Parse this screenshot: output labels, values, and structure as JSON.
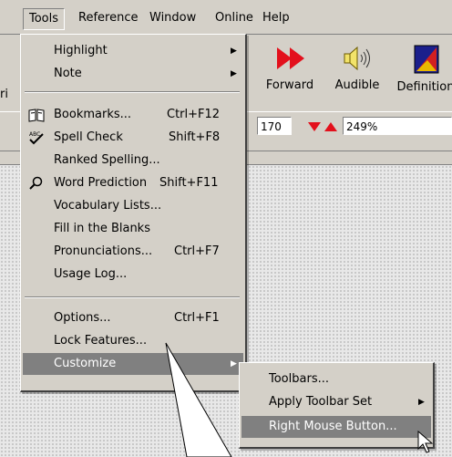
{
  "menubar": {
    "items": [
      "Tools",
      "Reference",
      "Window",
      "Online",
      "Help"
    ]
  },
  "toolbar": {
    "buttons": [
      {
        "label": "ri",
        "icon": "partial-button-icon"
      },
      {
        "label": "Forward",
        "icon": "forward-arrows-icon"
      },
      {
        "label": "Audible",
        "icon": "speaker-icon"
      },
      {
        "label": "Definition",
        "icon": "dictionary-book-icon"
      }
    ],
    "field1": "170",
    "zoom": "249%"
  },
  "tools_menu": {
    "items": [
      {
        "label": "Highlight",
        "shortcut": "",
        "submenu": true
      },
      {
        "label": "Note",
        "shortcut": "",
        "submenu": true
      },
      {
        "label": "Bookmarks...",
        "shortcut": "Ctrl+F12",
        "icon": "bookmarks-book-icon"
      },
      {
        "label": "Spell Check",
        "shortcut": "Shift+F8",
        "icon": "spellcheck-icon"
      },
      {
        "label": "Ranked Spelling...",
        "shortcut": ""
      },
      {
        "label": "Word Prediction",
        "shortcut": "Shift+F11",
        "icon": "magnifier-icon"
      },
      {
        "label": "Vocabulary Lists...",
        "shortcut": ""
      },
      {
        "label": "Fill in the Blanks",
        "shortcut": ""
      },
      {
        "label": "Pronunciations...",
        "shortcut": "Ctrl+F7"
      },
      {
        "label": "Usage Log...",
        "shortcut": ""
      },
      {
        "label": "Options...",
        "shortcut": "Ctrl+F1"
      },
      {
        "label": "Lock Features...",
        "shortcut": ""
      },
      {
        "label": "Customize",
        "shortcut": "",
        "submenu": true,
        "highlighted": true
      }
    ]
  },
  "customize_menu": {
    "items": [
      {
        "label": "Toolbars...",
        "submenu": false
      },
      {
        "label": "Apply Toolbar Set",
        "submenu": true
      },
      {
        "label": "Right Mouse Button...",
        "submenu": false,
        "highlighted": true
      }
    ]
  }
}
